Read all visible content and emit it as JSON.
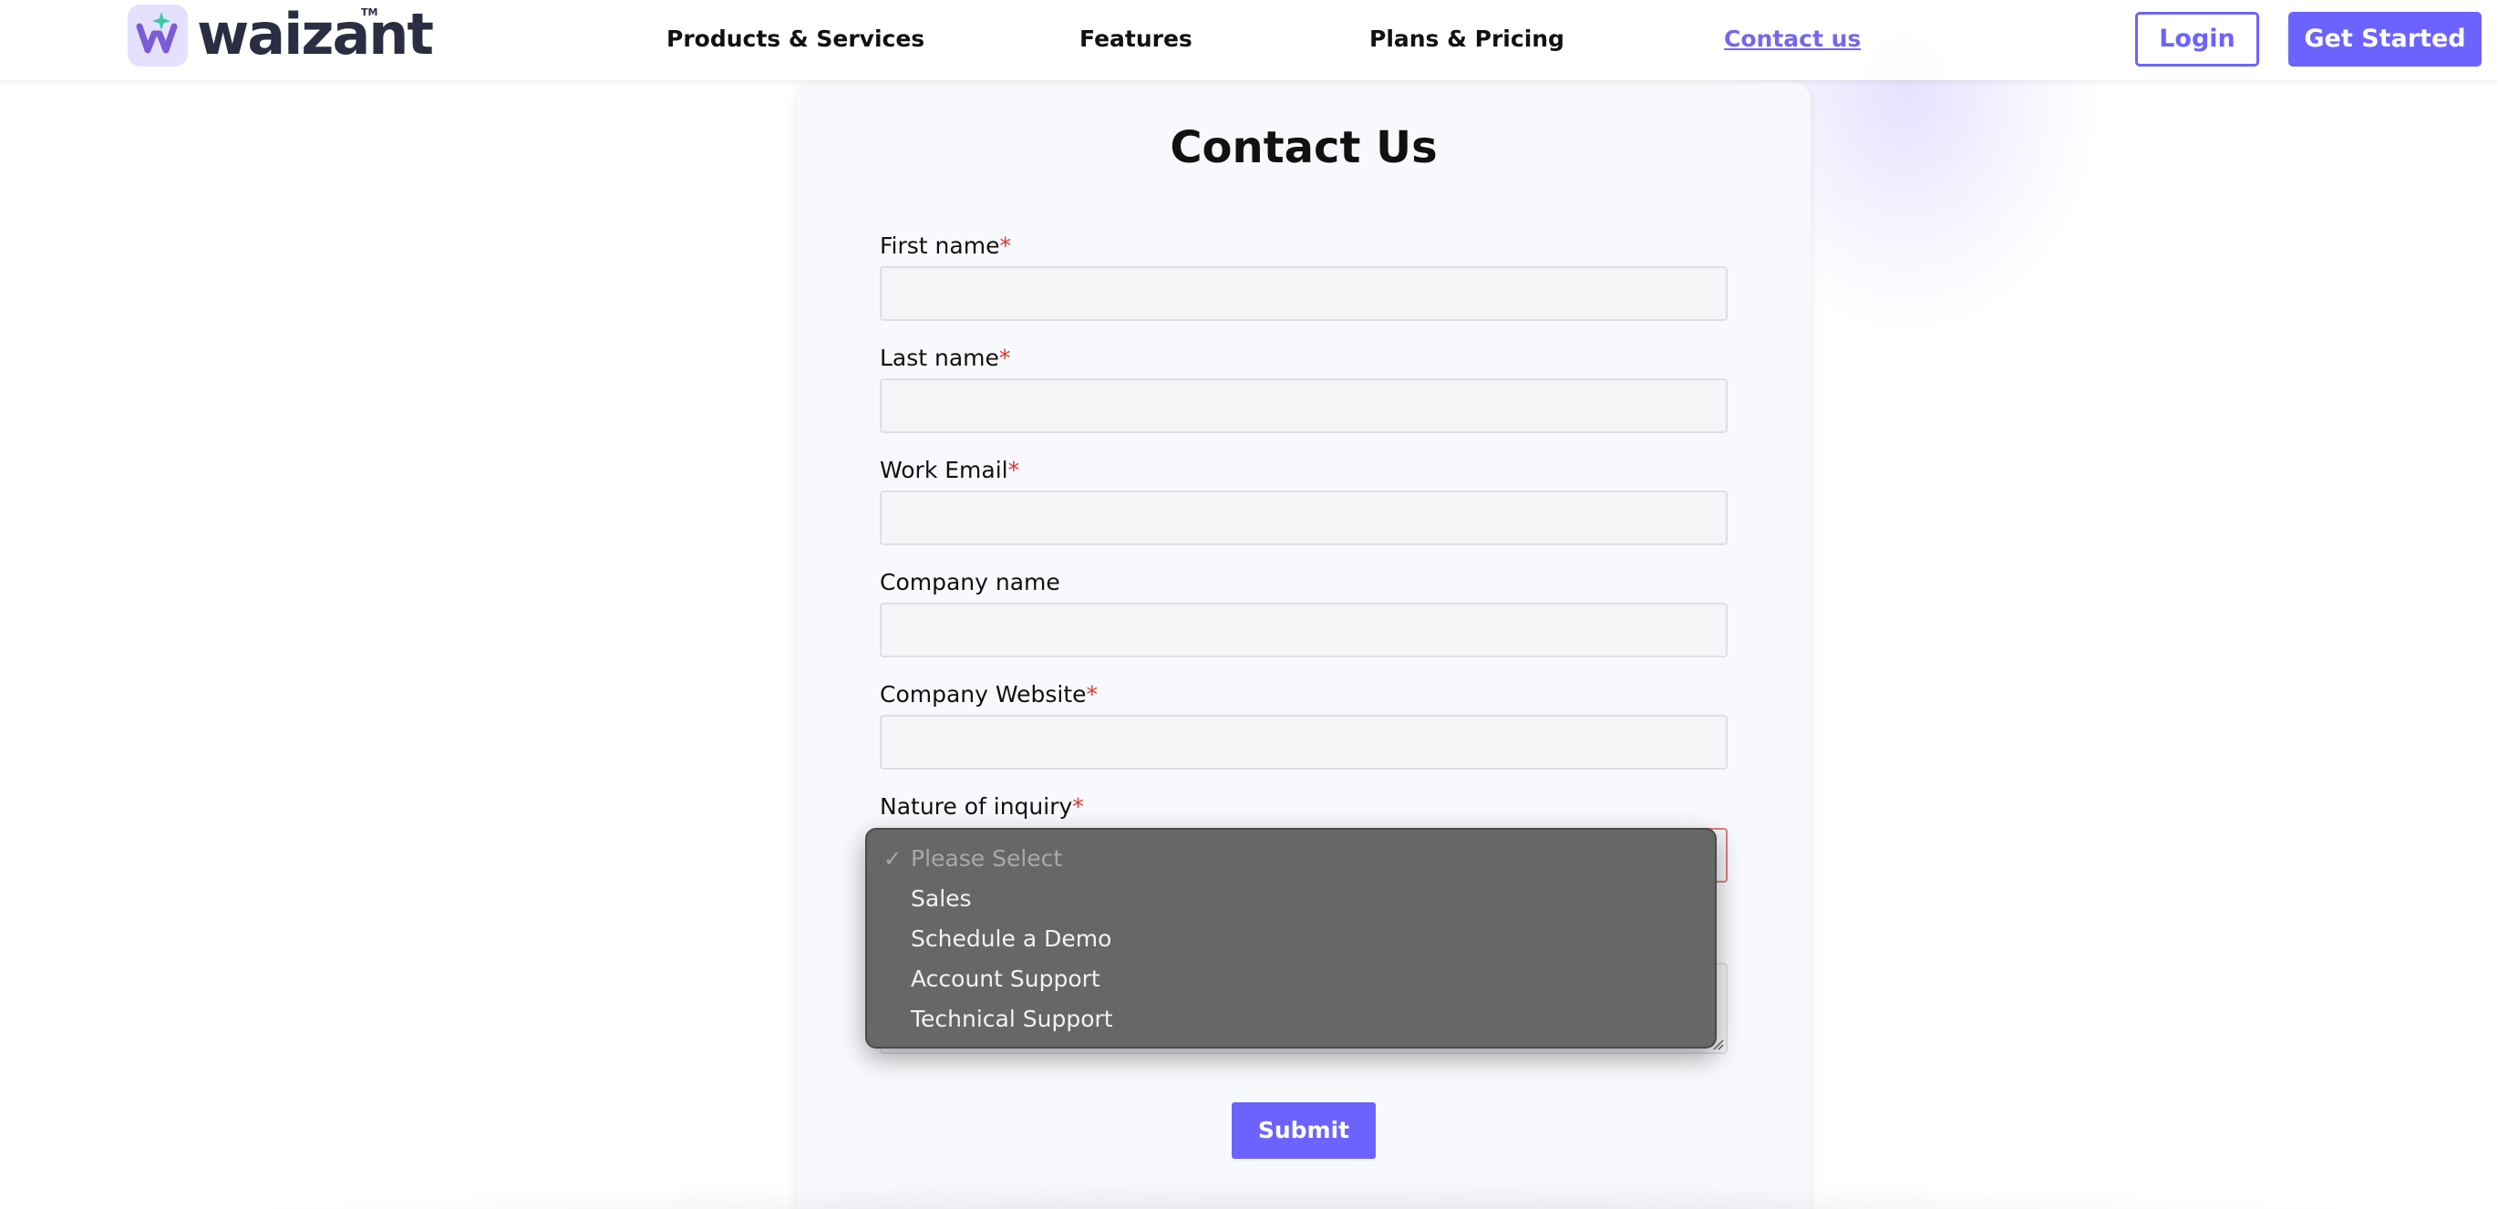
{
  "header": {
    "brand": "waizant",
    "brand_mark": "TM",
    "nav": [
      {
        "label": "Products & Services"
      },
      {
        "label": "Features"
      },
      {
        "label": "Plans & Pricing"
      },
      {
        "label": "Contact us",
        "active": true
      }
    ],
    "login_label": "Login",
    "cta_label": "Get Started"
  },
  "form": {
    "title": "Contact Us",
    "required_mark": "*",
    "fields": [
      {
        "label": "First name",
        "required": true,
        "value": ""
      },
      {
        "label": "Last name",
        "required": true,
        "value": ""
      },
      {
        "label": "Work Email",
        "required": true,
        "value": ""
      },
      {
        "label": "Company name",
        "required": false,
        "value": ""
      },
      {
        "label": "Company Website",
        "required": true,
        "value": ""
      }
    ],
    "inquiry": {
      "label": "Nature of inquiry",
      "required": true,
      "selected": "Please Select",
      "options": [
        "Please Select",
        "Sales",
        "Schedule a Demo",
        "Account Support",
        "Technical Support"
      ]
    },
    "submit_label": "Submit"
  },
  "icons": {
    "logo": "w-sparkle-logo-icon",
    "check": "checkmark-icon",
    "select": "chevron-down-icon"
  },
  "colors": {
    "accent": "#6c63ff",
    "required": "#e03131",
    "logo_bg": "#e4e1ff",
    "dropdown_bg": "#626262"
  }
}
